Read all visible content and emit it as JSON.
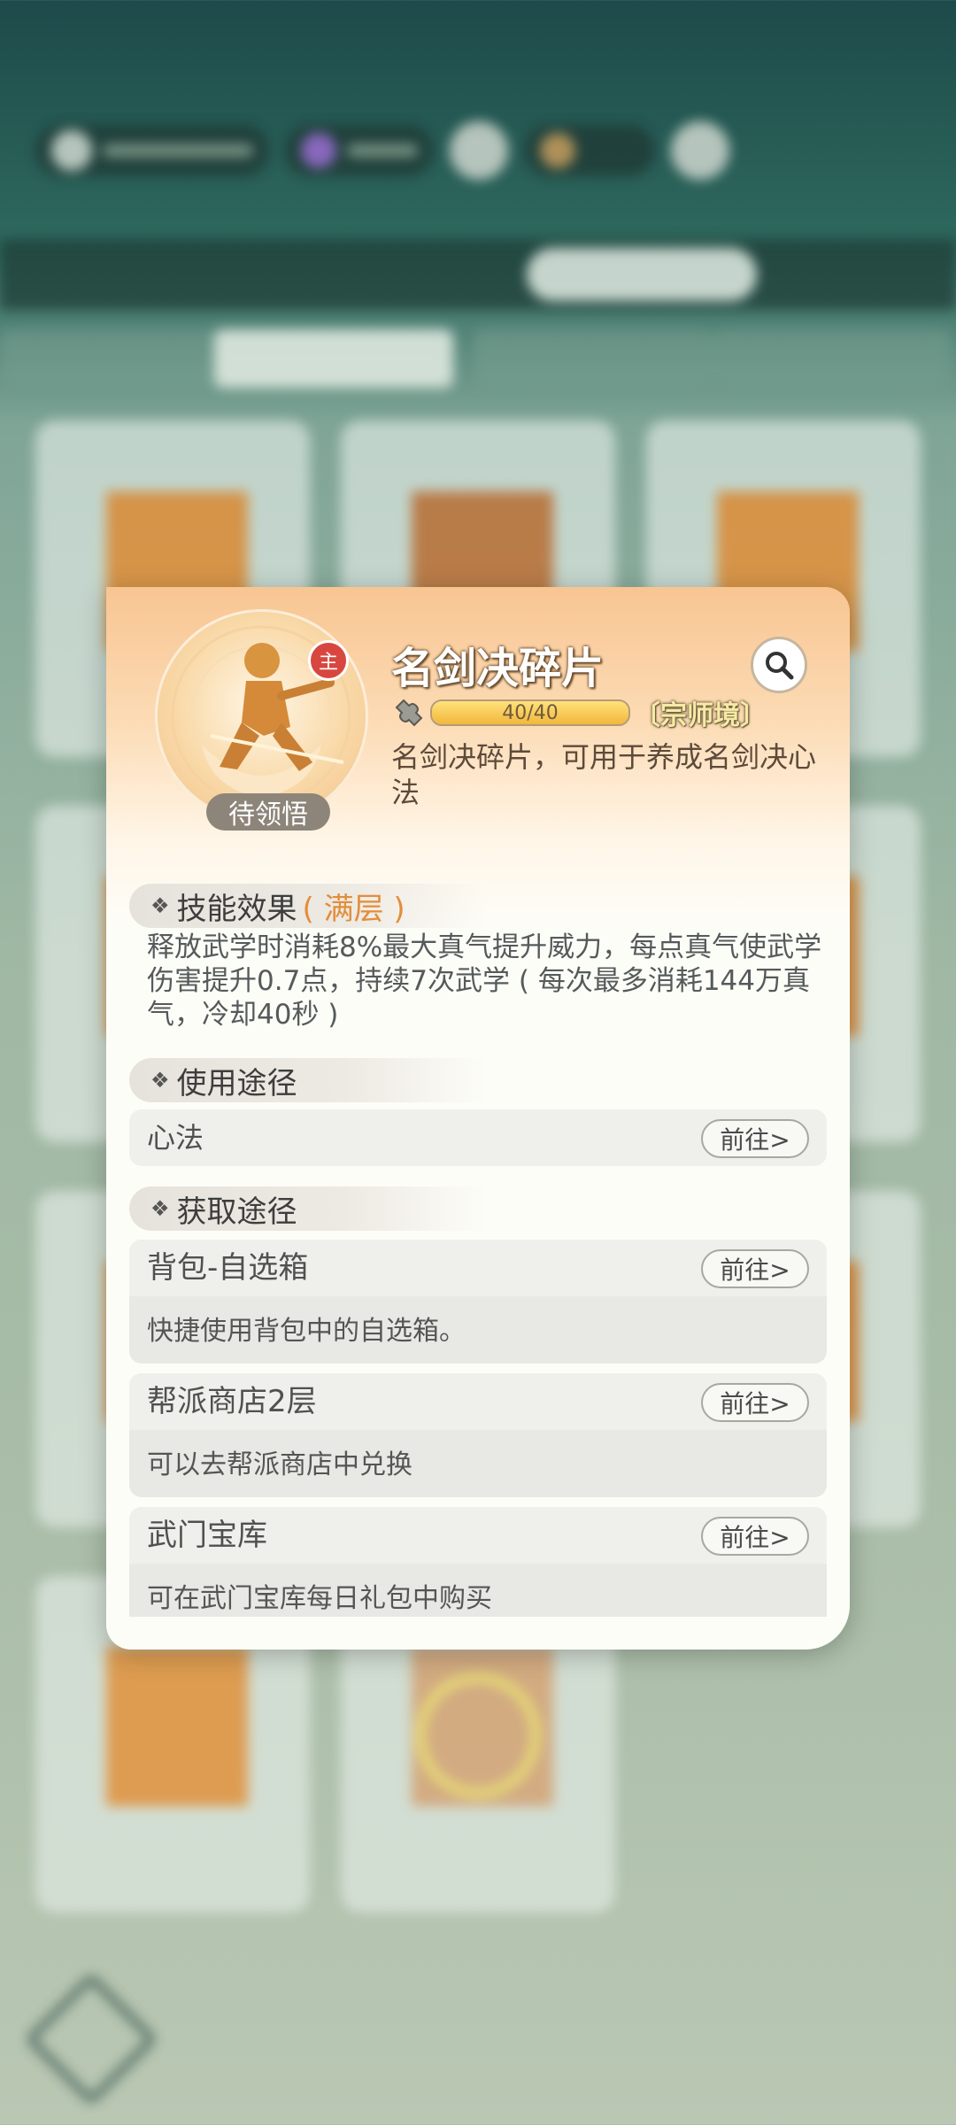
{
  "background": {
    "shop_tabs": [
      "",
      "",
      "",
      ""
    ],
    "floor_tabs": [
      "",
      "",
      "",
      ""
    ]
  },
  "popup": {
    "item_name": "名剑决碎片",
    "main_badge": "主",
    "status_tag": "待领悟",
    "progress": {
      "current": 40,
      "max": 40,
      "text": "40/40"
    },
    "realm": "〔宗师境〕",
    "description": "名剑决碎片，可用于养成名剑决心法",
    "skill_effect": {
      "title": "技能效果",
      "level": "( 满层 )",
      "text": "释放武学时消耗8%最大真气提升威力，每点真气使武学伤害提升0.7点，持续7次武学 ( 每次最多消耗144万真气，冷却40秒 )"
    },
    "usage": {
      "title": "使用途径",
      "items": [
        {
          "label": "心法",
          "button": "前往>"
        }
      ]
    },
    "obtain": {
      "title": "获取途径",
      "items": [
        {
          "label": "背包-自选箱",
          "button": "前往>",
          "desc": "快捷使用背包中的自选箱。"
        },
        {
          "label": "帮派商店2层",
          "button": "前往>",
          "desc": "可以去帮派商店中兑换"
        },
        {
          "label": "武门宝库",
          "button": "前往>",
          "desc": "可在武门宝库每日礼包中购买"
        }
      ]
    }
  },
  "colors": {
    "accent_orange": "#e38d3a",
    "badge_red": "#d8473f",
    "popup_header": "#f8c592"
  }
}
